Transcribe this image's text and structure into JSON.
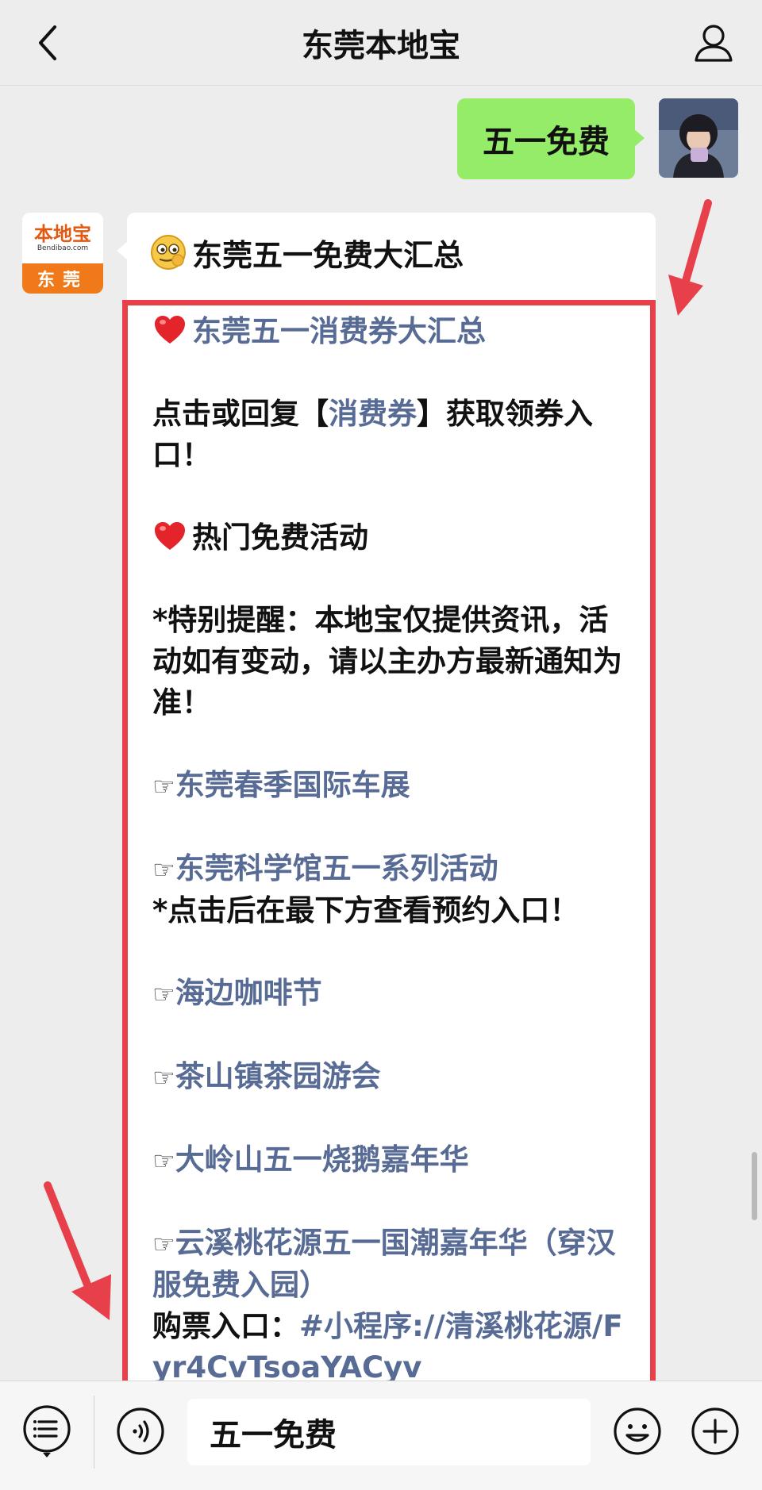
{
  "topbar": {
    "title": "东莞本地宝"
  },
  "self_message": {
    "text": "五一免费"
  },
  "bot": {
    "avatar_logo": "本地宝",
    "avatar_sub": "Bendibao.com",
    "avatar_city": "东莞",
    "header": "东莞五一免费大汇总"
  },
  "content": {
    "coupon_title": "东莞五一消费券大汇总",
    "coupon_prefix": "点击或回复【",
    "coupon_link": "消费券",
    "coupon_suffix": "】获取领券入口！",
    "hot_title": "热门免费活动",
    "notice": "*特别提醒：本地宝仅提供资讯，活动如有变动，请以主办方最新通知为准！",
    "hand_glyph": "☞",
    "items": [
      {
        "label": "东莞春季国际车展"
      },
      {
        "label": "东莞科学馆五一系列活动",
        "note": "*点击后在最下方查看预约入口！"
      },
      {
        "label": "海边咖啡节"
      },
      {
        "label": "茶山镇茶园游会"
      },
      {
        "label": "大岭山五一烧鹅嘉年华"
      },
      {
        "label": "云溪桃花源五一国潮嘉年华（穿汉服免费入园）"
      }
    ],
    "ticket_prefix": "购票入口：",
    "ticket_link": "#小程序://清溪桃花源/Fyr4CvTsoaYACyv"
  },
  "input": {
    "value": "五一免费"
  },
  "colors": {
    "link": "#576b95",
    "self_bubble": "#95ec69",
    "highlight_frame": "#e8404a",
    "arrow": "#e8404a",
    "avatar_orange": "#f07a1a"
  },
  "icons": {
    "back": "chevron-left-icon",
    "profile": "person-icon",
    "heart": "heart-icon",
    "hand": "pointing-hand-icon",
    "menu": "list-menu-icon",
    "voice": "voice-icon",
    "emoji": "smiley-icon",
    "plus": "plus-icon"
  }
}
